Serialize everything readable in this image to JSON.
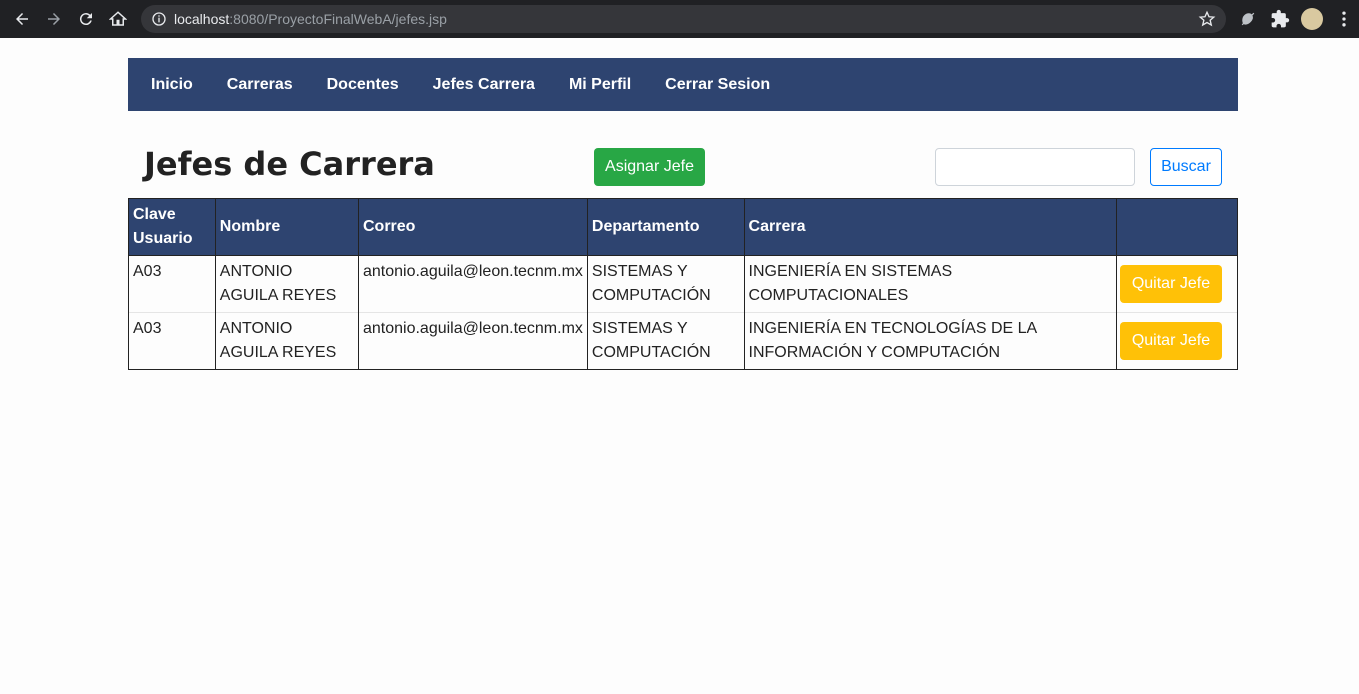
{
  "browser": {
    "url_host": "localhost",
    "url_rest": ":8080/ProyectoFinalWebA/jefes.jsp"
  },
  "nav": {
    "items": [
      "Inicio",
      "Carreras",
      "Docentes",
      "Jefes Carrera",
      "Mi Perfil",
      "Cerrar Sesion"
    ]
  },
  "header": {
    "title": "Jefes de Carrera",
    "assign_label": "Asignar Jefe",
    "search_value": "",
    "search_label": "Buscar"
  },
  "table": {
    "headers": [
      "Clave Usuario",
      "Nombre",
      "Correo",
      "Departamento",
      "Carrera",
      ""
    ],
    "rows": [
      {
        "clave": "A03",
        "nombre": "ANTONIO AGUILA REYES",
        "correo": "antonio.aguila@leon.tecnm.mx",
        "departamento": "SISTEMAS Y COMPUTACIÓN",
        "carrera": "INGENIERÍA EN SISTEMAS COMPUTACIONALES",
        "action": "Quitar Jefe"
      },
      {
        "clave": "A03",
        "nombre": "ANTONIO AGUILA REYES",
        "correo": "antonio.aguila@leon.tecnm.mx",
        "departamento": "SISTEMAS Y COMPUTACIÓN",
        "carrera": "INGENIERÍA EN TECNOLOGÍAS DE LA INFORMACIÓN Y COMPUTACIÓN",
        "action": "Quitar Jefe"
      }
    ]
  },
  "colors": {
    "nav_bg": "#2e4470",
    "success": "#28a745",
    "warning": "#ffc107",
    "primary": "#007bff"
  }
}
